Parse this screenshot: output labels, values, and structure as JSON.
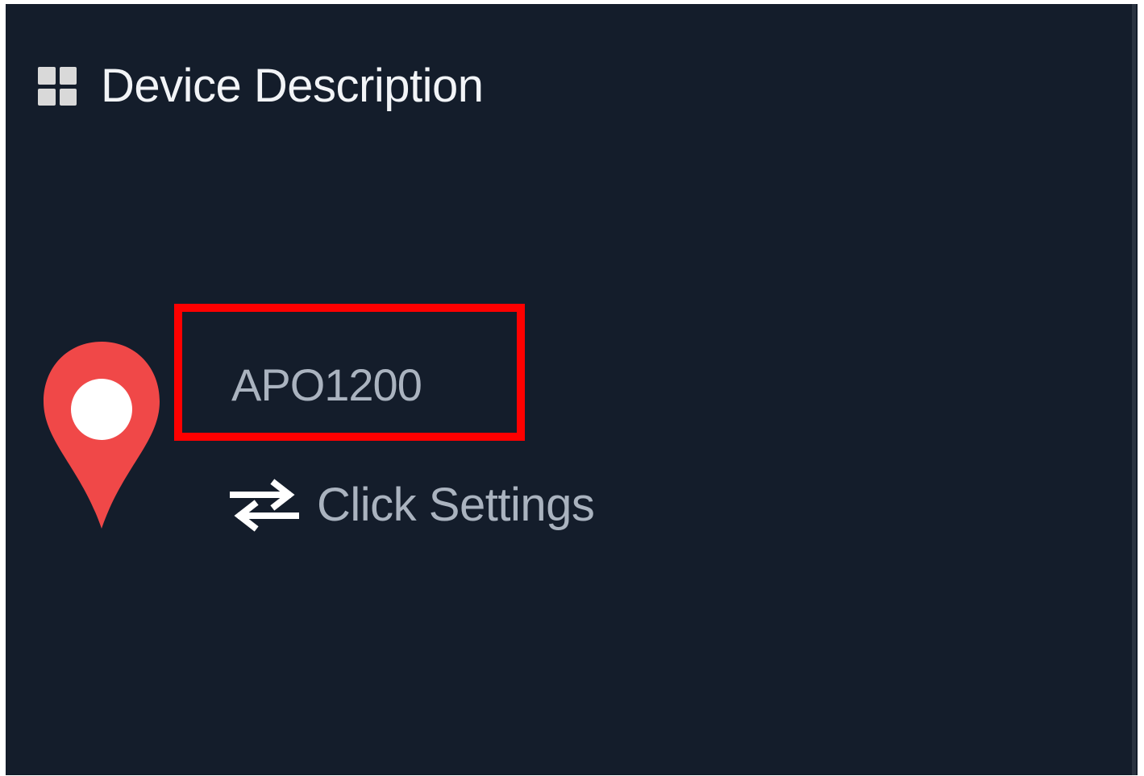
{
  "header": {
    "icon": "grid-icon",
    "title": "Device Description"
  },
  "device": {
    "icon": "map-pin-icon",
    "name": "APO1200",
    "highlight_color": "#ff0000"
  },
  "settings": {
    "icon": "swap-arrows-icon",
    "label": "Click Settings"
  },
  "colors": {
    "background": "#141d2b",
    "pin": "#f04848",
    "title_text": "#f2f4f7",
    "muted_text": "#aab3bf"
  }
}
